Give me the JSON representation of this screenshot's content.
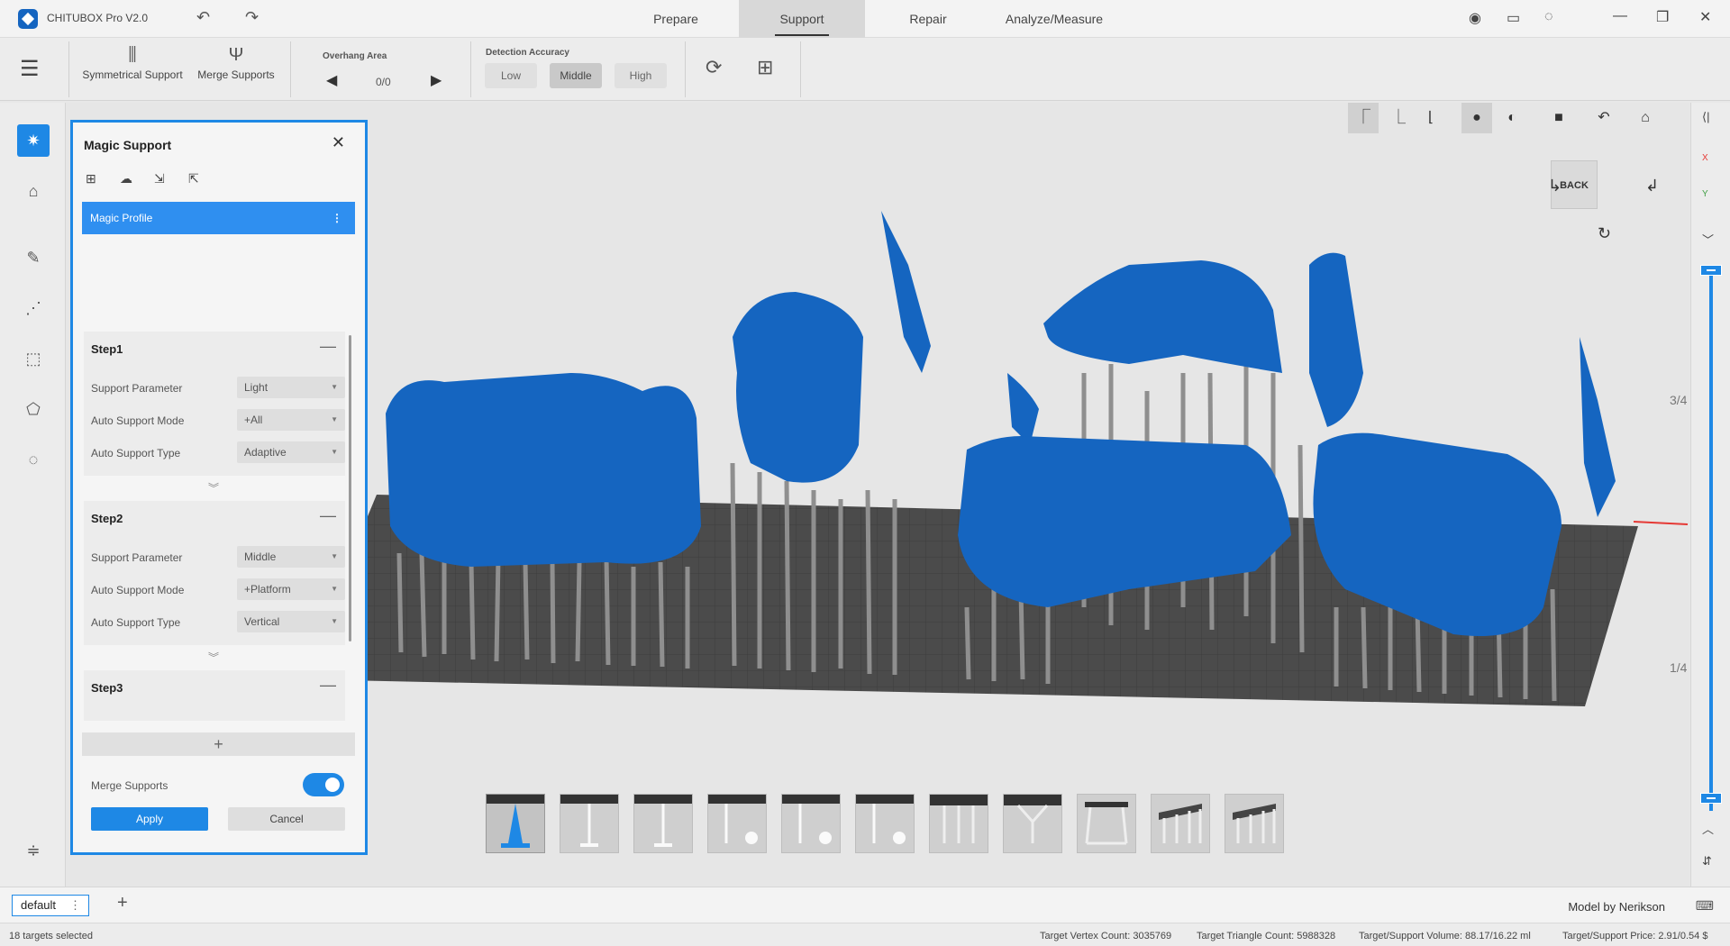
{
  "app": {
    "title": "CHITUBOX Pro V2.0"
  },
  "main_tabs": [
    {
      "label": "Prepare",
      "active": false
    },
    {
      "label": "Support",
      "active": true
    },
    {
      "label": "Repair",
      "active": false
    },
    {
      "label": "Analyze/Measure",
      "active": false
    }
  ],
  "toolbar": {
    "symmetrical_support": "Symmetrical Support",
    "merge_supports": "Merge Supports",
    "overhang_area_label": "Overhang Area",
    "overhang_counter": "0/0",
    "detection_accuracy_label": "Detection Accuracy",
    "accuracy_options": [
      "Low",
      "Middle",
      "High"
    ],
    "accuracy_selected": "Middle"
  },
  "magic_panel": {
    "title": "Magic Support",
    "profile": "Magic Profile",
    "steps": [
      {
        "title": "Step1",
        "rows": [
          {
            "label": "Support Parameter",
            "value": "Light"
          },
          {
            "label": "Auto Support Mode",
            "value": "+All"
          },
          {
            "label": "Auto Support Type",
            "value": "Adaptive"
          }
        ]
      },
      {
        "title": "Step2",
        "rows": [
          {
            "label": "Support Parameter",
            "value": "Middle"
          },
          {
            "label": "Auto Support Mode",
            "value": "+Platform"
          },
          {
            "label": "Auto Support Type",
            "value": "Vertical"
          }
        ]
      },
      {
        "title": "Step3"
      }
    ],
    "merge_supports_label": "Merge Supports",
    "merge_supports_on": true,
    "apply": "Apply",
    "cancel": "Cancel"
  },
  "view": {
    "cube_face": "BACK",
    "axis_x": "X",
    "axis_y": "Y",
    "fraction_top": "3/4",
    "fraction_bottom": "1/4"
  },
  "bottom": {
    "tab": "default",
    "model_by": "Model by Nerikson"
  },
  "status": {
    "selected": "18 targets selected",
    "vertex": "Target Vertex Count:  3035769",
    "triangle": "Target Triangle Count:  5988328",
    "volume": "Target/Support Volume:  88.17/16.22  ml",
    "price": "Target/Support Price:  2.91/0.54  $"
  },
  "colors": {
    "accent": "#1e88e5",
    "model": "#1565c0",
    "support": "#8f8f8f",
    "plate": "#4a4a4a"
  }
}
